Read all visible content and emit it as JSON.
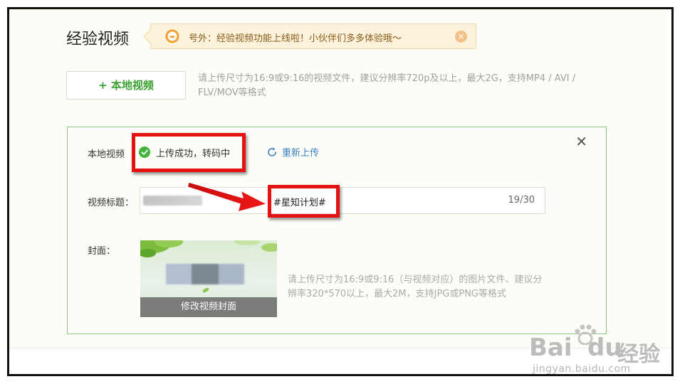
{
  "page": {
    "title": "经验视频"
  },
  "notice": {
    "text": "号外：经验视频功能上线啦！小伙伴们多多体验哦～",
    "icon": "smile-face-icon",
    "close_icon": "×",
    "color": "#f0a030"
  },
  "upload": {
    "button_label": "+ 本地视频",
    "hint": "请上传尺寸为16:9或9:16的视频文件，建议分辨率720p及以上，最大2G，支持MP4 / AVI / FLV/MOV等格式"
  },
  "form": {
    "close_icon": "✕",
    "local_video_label": "本地视频",
    "status_text": "上传成功，转码中",
    "status_color": "#44b23d",
    "reupload_label": "重新上传",
    "title_label": "视频标题：",
    "title_value": "#星知计划#",
    "title_count": "19/30",
    "cover_label": "封面：",
    "cover_button": "修改视频封面",
    "cover_hint": "请上传尺寸为16:9或9:16（与视频对应）的图片文件、建议分辨率320*570以上，最大2M，支持JPG或PNG等格式"
  },
  "annotation": {
    "highlight_color": "#e51212"
  },
  "watermark": {
    "brand_bai": "Bai",
    "brand_du": "du",
    "brand_cn": "经验",
    "url": "jingyan.baidu.com"
  }
}
